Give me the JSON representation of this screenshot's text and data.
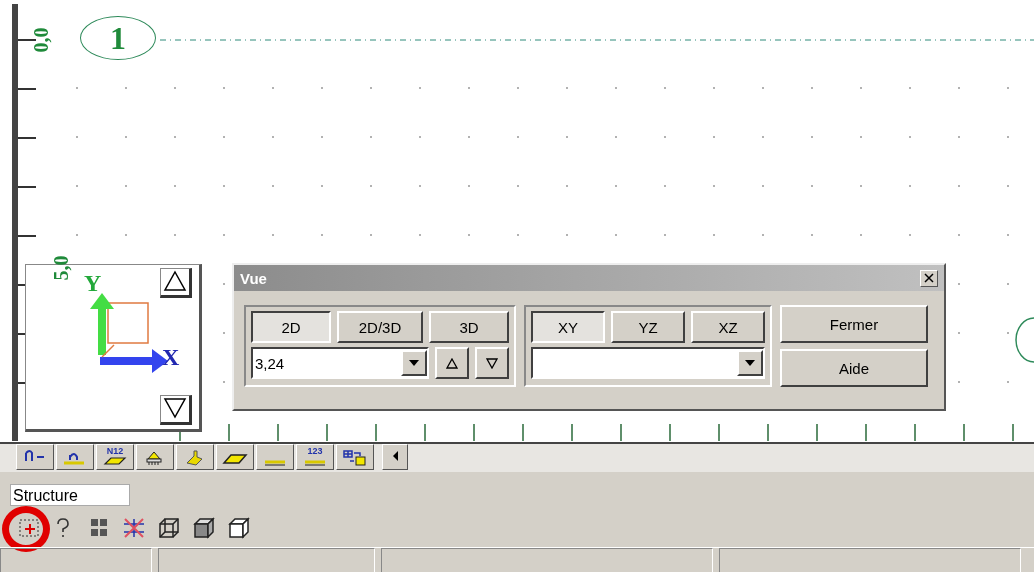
{
  "canvas": {
    "axis_marker": "1",
    "coordinates": [
      {
        "label": "0,0",
        "kind": "top"
      },
      {
        "label": "5,0",
        "kind": "middle"
      }
    ]
  },
  "view_widget": {
    "axes": [
      {
        "label": "Y",
        "kind": "vertical"
      },
      {
        "label": "X",
        "kind": "horizontal"
      }
    ]
  },
  "dialog": {
    "title": "Vue",
    "modes": [
      {
        "label": "2D",
        "selected": true
      },
      {
        "label": "2D/3D",
        "selected": false
      },
      {
        "label": "3D",
        "selected": false
      }
    ],
    "zoom": {
      "value": "3,24"
    },
    "planes": [
      {
        "label": "XY",
        "selected": true
      },
      {
        "label": "YZ",
        "selected": false
      },
      {
        "label": "XZ",
        "selected": false
      }
    ],
    "buttons": [
      "Fermer",
      "Aide"
    ]
  },
  "tab_toolbar": {
    "tools": [
      {
        "kind": "node-dash"
      },
      {
        "kind": "node-line"
      },
      {
        "kind": "plate-number",
        "label": "N12"
      },
      {
        "kind": "support"
      },
      {
        "kind": "load"
      },
      {
        "kind": "plate"
      },
      {
        "kind": "dimension"
      },
      {
        "kind": "numbers",
        "label": "123"
      },
      {
        "kind": "swap"
      },
      {
        "kind": "scroll-left"
      }
    ]
  },
  "structure_panel": {
    "label": "Structure",
    "tools": [
      {
        "kind": "zoom-window",
        "highlighted": true
      },
      {
        "kind": "help",
        "highlighted": false
      },
      {
        "kind": "grid",
        "highlighted": false
      },
      {
        "kind": "cut",
        "highlighted": false
      },
      {
        "kind": "wire-cube",
        "highlighted": false
      },
      {
        "kind": "shaded-cube",
        "highlighted": false
      },
      {
        "kind": "outline-cube",
        "highlighted": false
      }
    ]
  }
}
